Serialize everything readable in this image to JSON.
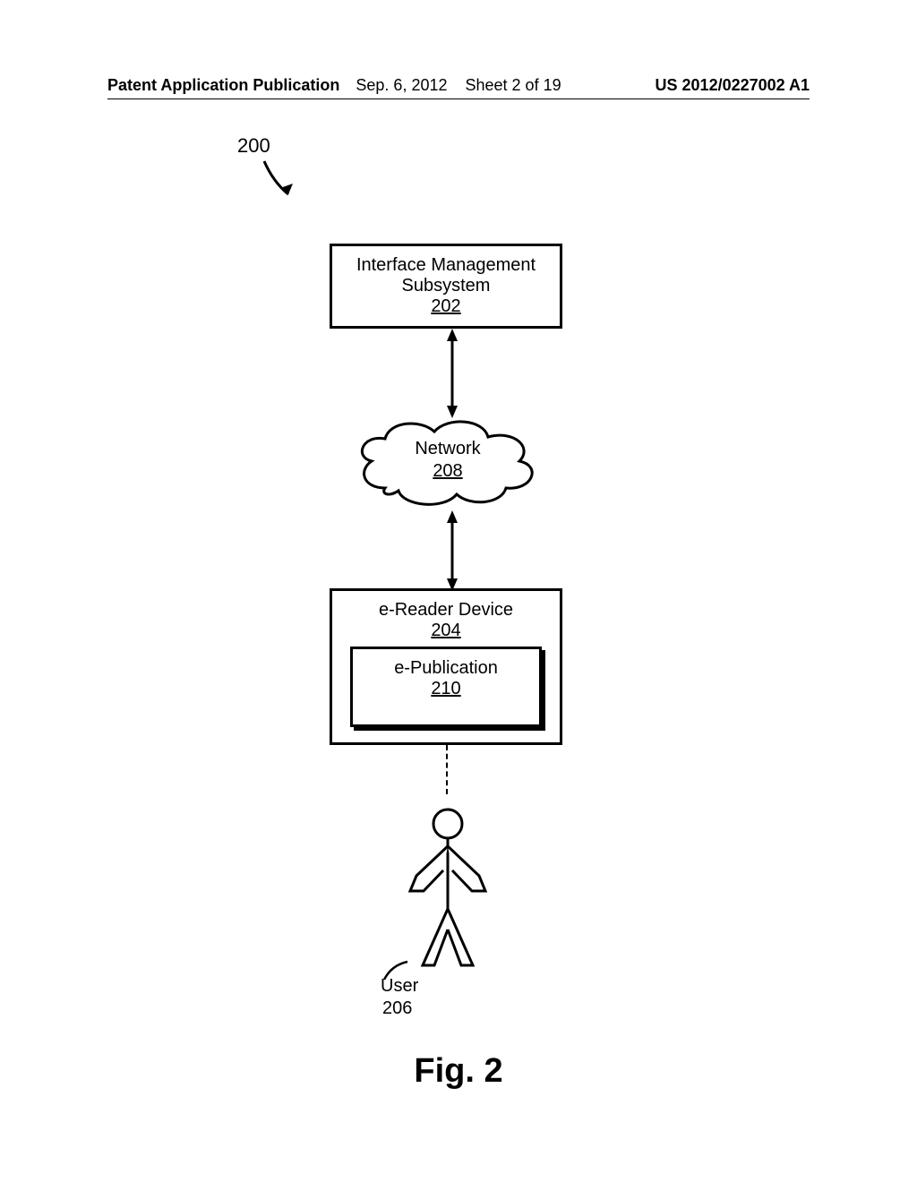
{
  "header": {
    "left": "Patent Application Publication",
    "center_date": "Sep. 6, 2012",
    "center_sheet": "Sheet 2 of 19",
    "right": "US 2012/0227002 A1"
  },
  "ref_200": "200",
  "interface": {
    "line1": "Interface Management",
    "line2": "Subsystem",
    "ref": "202"
  },
  "network": {
    "label": "Network",
    "ref": "208"
  },
  "ereader": {
    "label": "e-Reader Device",
    "ref": "204"
  },
  "epub": {
    "label": "e-Publication",
    "ref": "210"
  },
  "user": {
    "label": "User",
    "ref": "206"
  },
  "figure": "Fig. 2"
}
